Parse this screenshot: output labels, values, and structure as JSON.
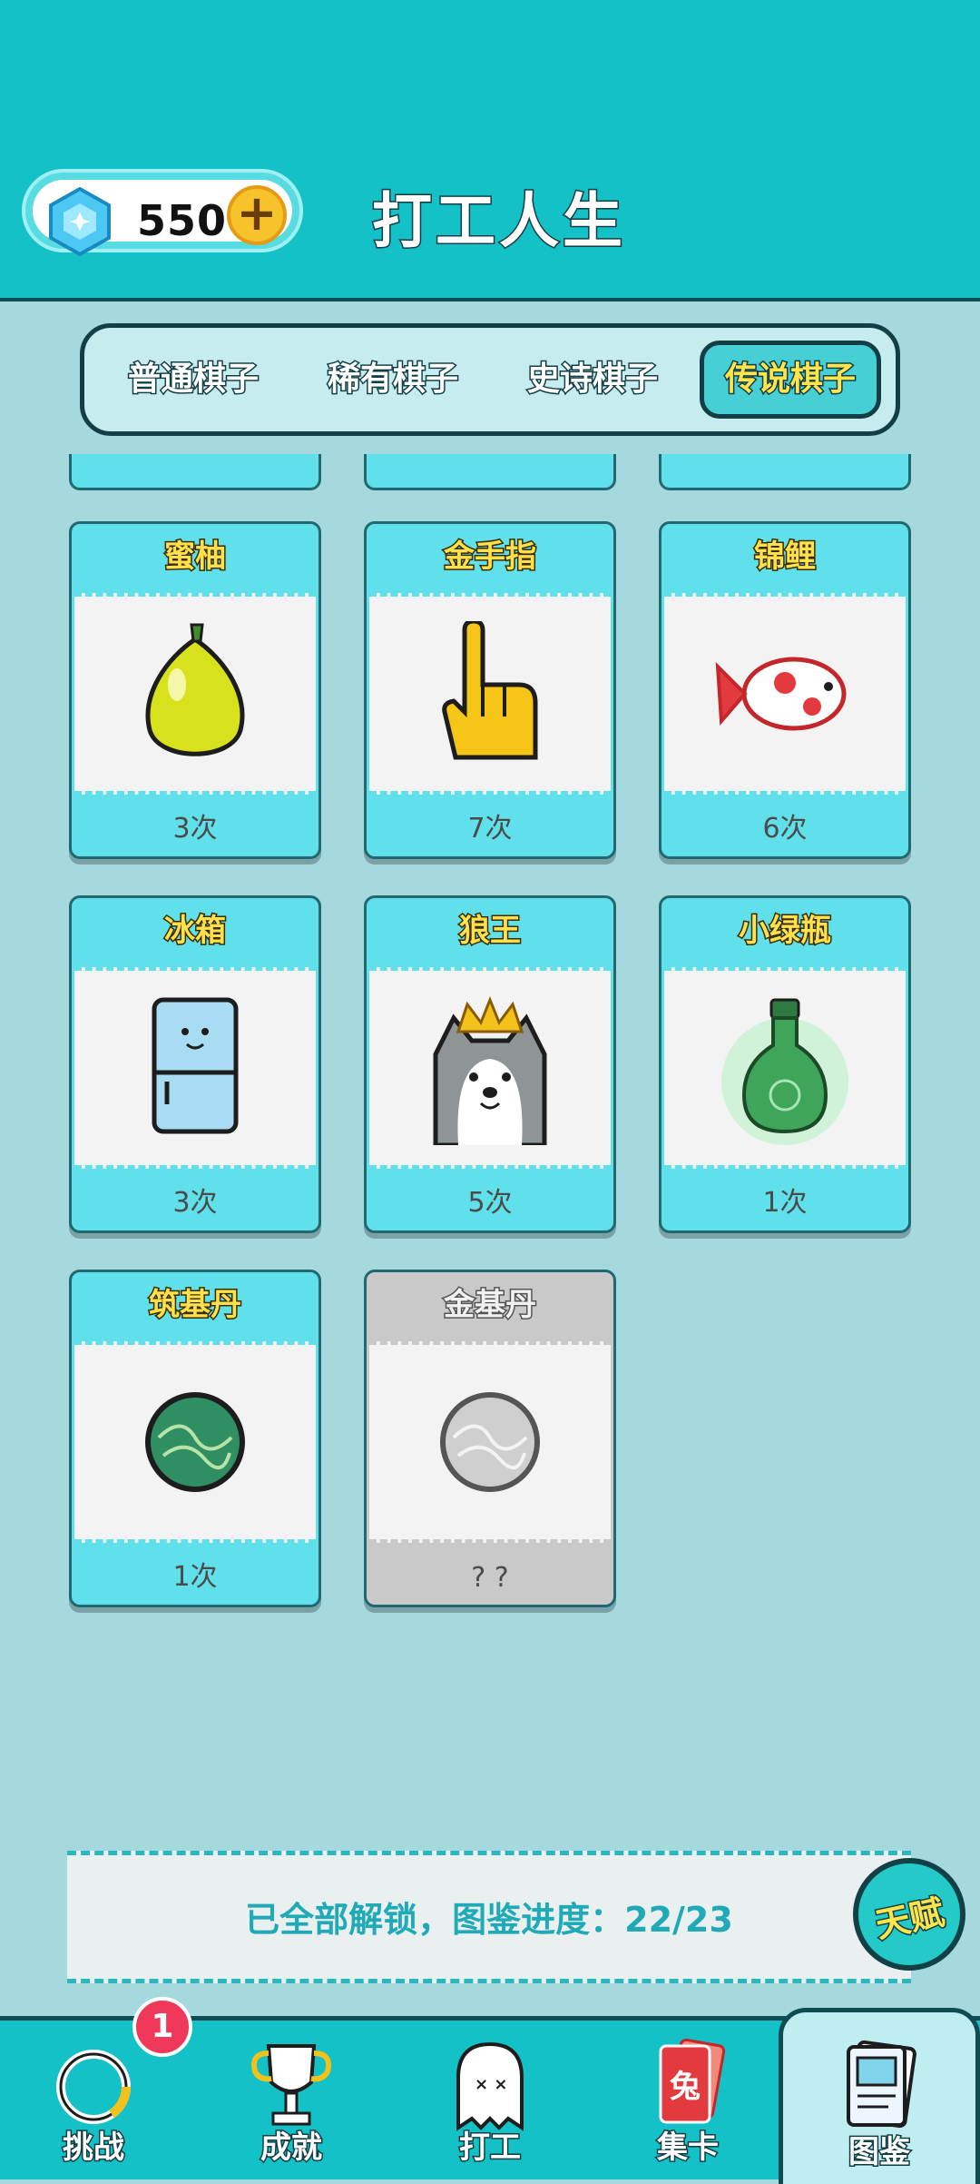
{
  "header": {
    "gem_count": "550",
    "plus": "+",
    "title": "打工人生"
  },
  "tabs": [
    {
      "label": "普通棋子",
      "active": false
    },
    {
      "label": "稀有棋子",
      "active": false
    },
    {
      "label": "史诗棋子",
      "active": false
    },
    {
      "label": "传说棋子",
      "active": true
    }
  ],
  "cards": [
    {
      "name": "蜜柚",
      "count": "3次",
      "icon": "pomelo-icon"
    },
    {
      "name": "金手指",
      "count": "7次",
      "icon": "golden-finger-icon"
    },
    {
      "name": "锦鲤",
      "count": "6次",
      "icon": "koi-fish-icon"
    },
    {
      "name": "冰箱",
      "count": "3次",
      "icon": "fridge-icon"
    },
    {
      "name": "狼王",
      "count": "5次",
      "icon": "wolf-king-icon"
    },
    {
      "name": "小绿瓶",
      "count": "1次",
      "icon": "green-bottle-icon"
    },
    {
      "name": "筑基丹",
      "count": "1次",
      "icon": "foundation-pill-icon"
    },
    {
      "name": "金基丹",
      "count": "? ?",
      "icon": "golden-pill-icon",
      "locked": true
    }
  ],
  "progress": {
    "text": "已全部解锁，图鉴进度：22/23"
  },
  "talent": {
    "label": "天赋"
  },
  "nav": [
    {
      "label": "挑战",
      "icon": "challenge-icon",
      "badge": "1"
    },
    {
      "label": "成就",
      "icon": "trophy-icon"
    },
    {
      "label": "打工",
      "icon": "ghost-icon"
    },
    {
      "label": "集卡",
      "icon": "card-collection-icon",
      "card_glyph": "兔"
    },
    {
      "label": "图鉴",
      "icon": "book-icon",
      "active": true
    }
  ],
  "colors": {
    "header_bg": "#13c1c6",
    "page_bg": "#a5d9de",
    "card_bg": "#5fe0eb",
    "name_yellow": "#ffe14d",
    "progress_text": "#20aab8",
    "badge_red": "#f0395a"
  }
}
